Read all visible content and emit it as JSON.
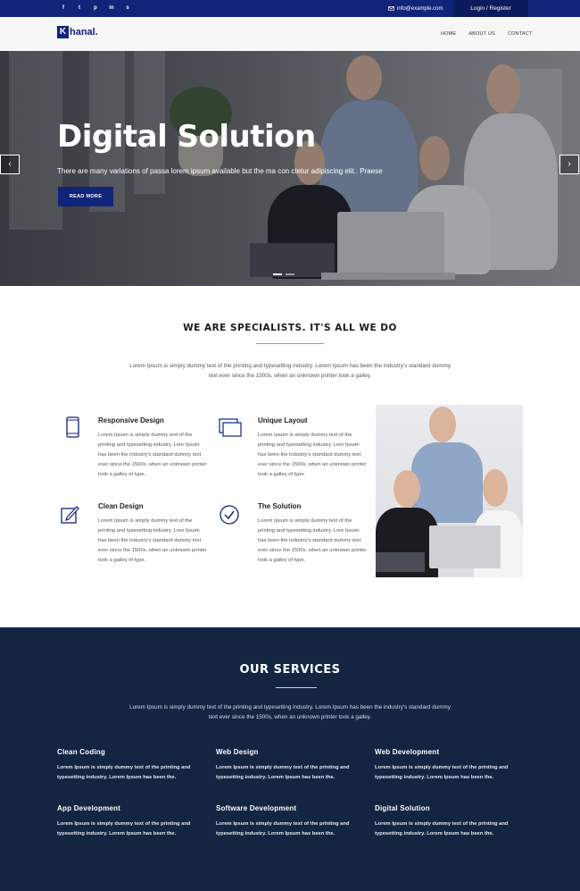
{
  "topbar": {
    "social_icons": [
      {
        "icon": "facebook-icon",
        "glyph": "f"
      },
      {
        "icon": "twitter-icon",
        "glyph": "t"
      },
      {
        "icon": "pinterest-icon",
        "glyph": "p"
      },
      {
        "icon": "linkedin-icon",
        "glyph": "in"
      },
      {
        "icon": "skype-icon",
        "glyph": "s"
      }
    ],
    "email": "info@example.com",
    "login_label": "Login / Register",
    "bg_color": "#10247a"
  },
  "navbar": {
    "logo_letter": "K",
    "logo_text": "hanal.",
    "links": [
      "HOME",
      "ABOUT US",
      "CONTACT"
    ]
  },
  "hero": {
    "title": "Digital Solution",
    "subtitle": "There are many variations of passa lorem ipsum available but the ma con ctetur adipiscing elit.. Praese",
    "button_label": "READ MORE",
    "prev_label": "‹",
    "next_label": "›"
  },
  "specialists": {
    "title": "WE ARE SPECIALISTS. IT'S ALL WE DO",
    "description": "Lorem Ipsum is simply dummy text of the printing and typesetting industry. Lorem Ipsum has been the industry's standard dummy text ever since the 1500s, when an unknown printer took a galley.",
    "features": [
      {
        "icon": "mobile-icon",
        "title": "Responsive Design",
        "text": "Lorem Ipsum is simply dummy text of the printing and typesetting industry. Lore Ipsum has been the industry's standard dummy text ever since the 1500s, when an unknown printer took a galley of type."
      },
      {
        "icon": "layers-icon",
        "title": "Unique Layout",
        "text": "Lorem Ipsum is simply dummy text of the printing and typesetting industry. Lore Ipsum has been the industry's standard dummy text ever since the 1500s, when an unknown printer took a galley of type."
      },
      {
        "icon": "edit-icon",
        "title": "Clean Design",
        "text": "Lorem Ipsum is simply dummy text of the printing and typesetting industry. Lore Ipsum has been the industry's standard dummy text ever since the 1500s, when an unknown printer took a galley of type."
      },
      {
        "icon": "check-circle-icon",
        "title": "The Solution",
        "text": "Lorem Ipsum is simply dummy text of the printing and typesetting industry. Lore Ipsum has been the industry's standard dummy text ever since the 1500s, when an unknown printer took a galley of type."
      }
    ]
  },
  "services": {
    "title": "OUR SERVICES",
    "description": "Lorem Ipsum is simply dummy text of the printing and typesetting industry. Lorem Ipsum has been the industry's standard dummy text ever since the 1500s, when an unknown printer took a galley.",
    "items": [
      {
        "title": "Clean Coding",
        "text": "Lorem Ipsum is simply dummy text of the printing and typesetting industry. Lorem Ipsum has been the."
      },
      {
        "title": "Web Design",
        "text": "Lorem Ipsum is simply dummy text of the printing and typesetting industry. Lorem Ipsum has been the."
      },
      {
        "title": "Web Development",
        "text": "Lorem Ipsum is simply dummy text of the printing and typesetting industry. Lorem Ipsum has been the."
      },
      {
        "title": "App Development",
        "text": "Lorem Ipsum is simply dummy text of the printing and typesetting industry. Lorem Ipsum has been the."
      },
      {
        "title": "Software Development",
        "text": "Lorem Ipsum is simply dummy text of the printing and typesetting industry. Lorem Ipsum has been the."
      },
      {
        "title": "Digital Solution",
        "text": "Lorem Ipsum is simply dummy text of the printing and typesetting industry. Lorem Ipsum has been the."
      }
    ],
    "bg_color": "#142542"
  }
}
